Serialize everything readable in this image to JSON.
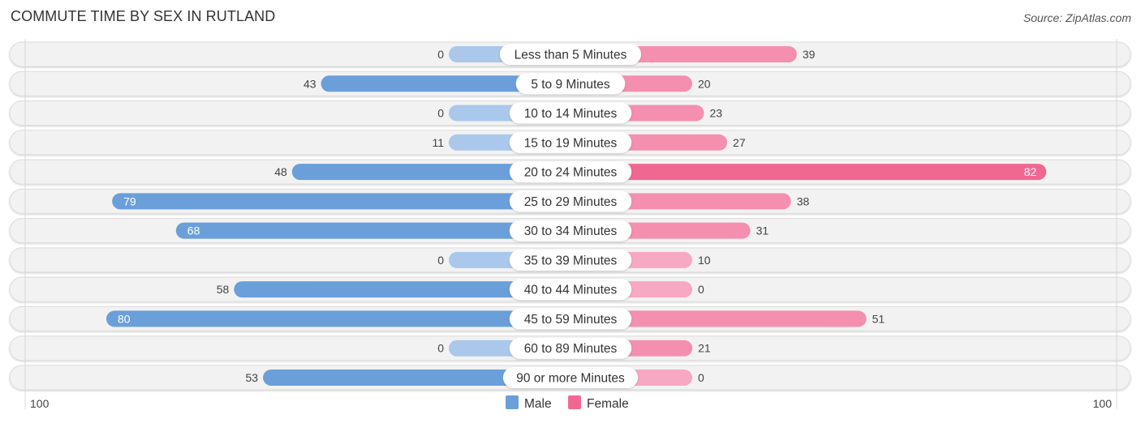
{
  "header": {
    "title": "COMMUTE TIME BY SEX IN RUTLAND",
    "source": "Source: ZipAtlas.com"
  },
  "colors": {
    "male": "#6a9fda",
    "male_light": "#a9c8eb",
    "female": "#f06892",
    "female_light": "#f7a8c2",
    "track": "#f2f2f2"
  },
  "chart_data": {
    "type": "bar",
    "orientation": "horizontal-diverging",
    "title": "COMMUTE TIME BY SEX IN RUTLAND",
    "categories": [
      "Less than 5 Minutes",
      "5 to 9 Minutes",
      "10 to 14 Minutes",
      "15 to 19 Minutes",
      "20 to 24 Minutes",
      "25 to 29 Minutes",
      "30 to 34 Minutes",
      "35 to 39 Minutes",
      "40 to 44 Minutes",
      "45 to 59 Minutes",
      "60 to 89 Minutes",
      "90 or more Minutes"
    ],
    "series": [
      {
        "name": "Male",
        "side": "left",
        "values": [
          0,
          43,
          0,
          11,
          48,
          79,
          68,
          0,
          58,
          80,
          0,
          53
        ]
      },
      {
        "name": "Female",
        "side": "right",
        "values": [
          39,
          20,
          23,
          27,
          82,
          38,
          31,
          10,
          0,
          51,
          21,
          0
        ]
      }
    ],
    "axis": {
      "left_label": "100",
      "right_label": "100",
      "range": [
        0,
        100
      ]
    },
    "legend": {
      "items": [
        "Male",
        "Female"
      ],
      "placement": "bottom-center"
    },
    "xlabel": "",
    "ylabel": ""
  }
}
